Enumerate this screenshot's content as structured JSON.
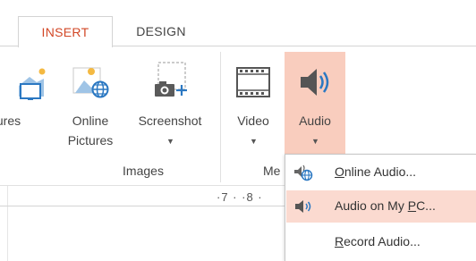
{
  "tabs": [
    {
      "label": "INSERT",
      "active": true
    },
    {
      "label": "DESIGN",
      "active": false
    }
  ],
  "ribbon": {
    "buttons": {
      "pictures": {
        "label": "tures",
        "icon": "pictures-icon"
      },
      "online_pictures": {
        "line1": "Online",
        "line2": "Pictures",
        "icon": "online-pictures-icon"
      },
      "screenshot": {
        "label": "Screenshot",
        "icon": "screenshot-icon",
        "has_dropdown": true
      },
      "video": {
        "label": "Video",
        "icon": "video-icon",
        "has_dropdown": true
      },
      "audio": {
        "label": "Audio",
        "icon": "speaker-icon",
        "has_dropdown": true,
        "pressed": true
      }
    },
    "groups": {
      "images": "Images",
      "media_truncated": "Me"
    }
  },
  "ruler": {
    "text": "·7 · ·8 ·"
  },
  "audio_menu": {
    "items": [
      {
        "label": "Online Audio...",
        "accel": "O",
        "rest": "nline Audio...",
        "icon": "online-audio-icon",
        "highlighted": false
      },
      {
        "label": "Audio on My PC...",
        "prefix": "Audio on My ",
        "accel": "P",
        "rest": "C...",
        "icon": "audio-file-icon",
        "highlighted": true
      },
      {
        "label": "Record Audio...",
        "accel": "R",
        "rest": "ecord Audio...",
        "icon": "",
        "highlighted": false
      }
    ]
  },
  "colors": {
    "accent": "#d24726",
    "pressed_bg": "#f9cdbe",
    "menu_hover_bg": "#fbdad0"
  }
}
